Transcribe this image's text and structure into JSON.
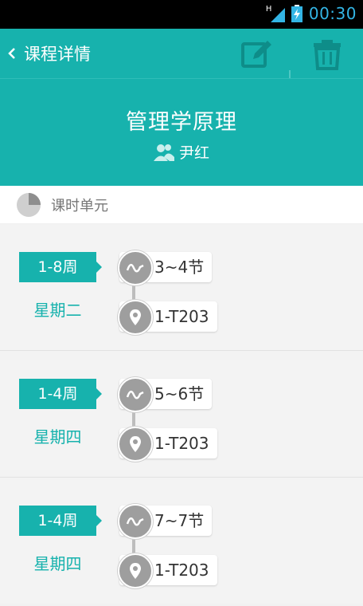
{
  "status_bar": {
    "network": "H",
    "time": "00:30"
  },
  "toolbar": {
    "title": "课程详情"
  },
  "course": {
    "name": "管理学原理",
    "teacher": "尹红"
  },
  "section": {
    "label": "课时单元"
  },
  "units": [
    {
      "weeks": "1-8周",
      "weekday": "星期二",
      "periods": "3~4节",
      "room": "1-T203"
    },
    {
      "weeks": "1-4周",
      "weekday": "星期四",
      "periods": "5~6节",
      "room": "1-T203"
    },
    {
      "weeks": "1-4周",
      "weekday": "星期四",
      "periods": "7~7节",
      "room": "1-T203"
    }
  ],
  "colors": {
    "accent": "#17b2ad",
    "status_time": "#33b5e5"
  }
}
